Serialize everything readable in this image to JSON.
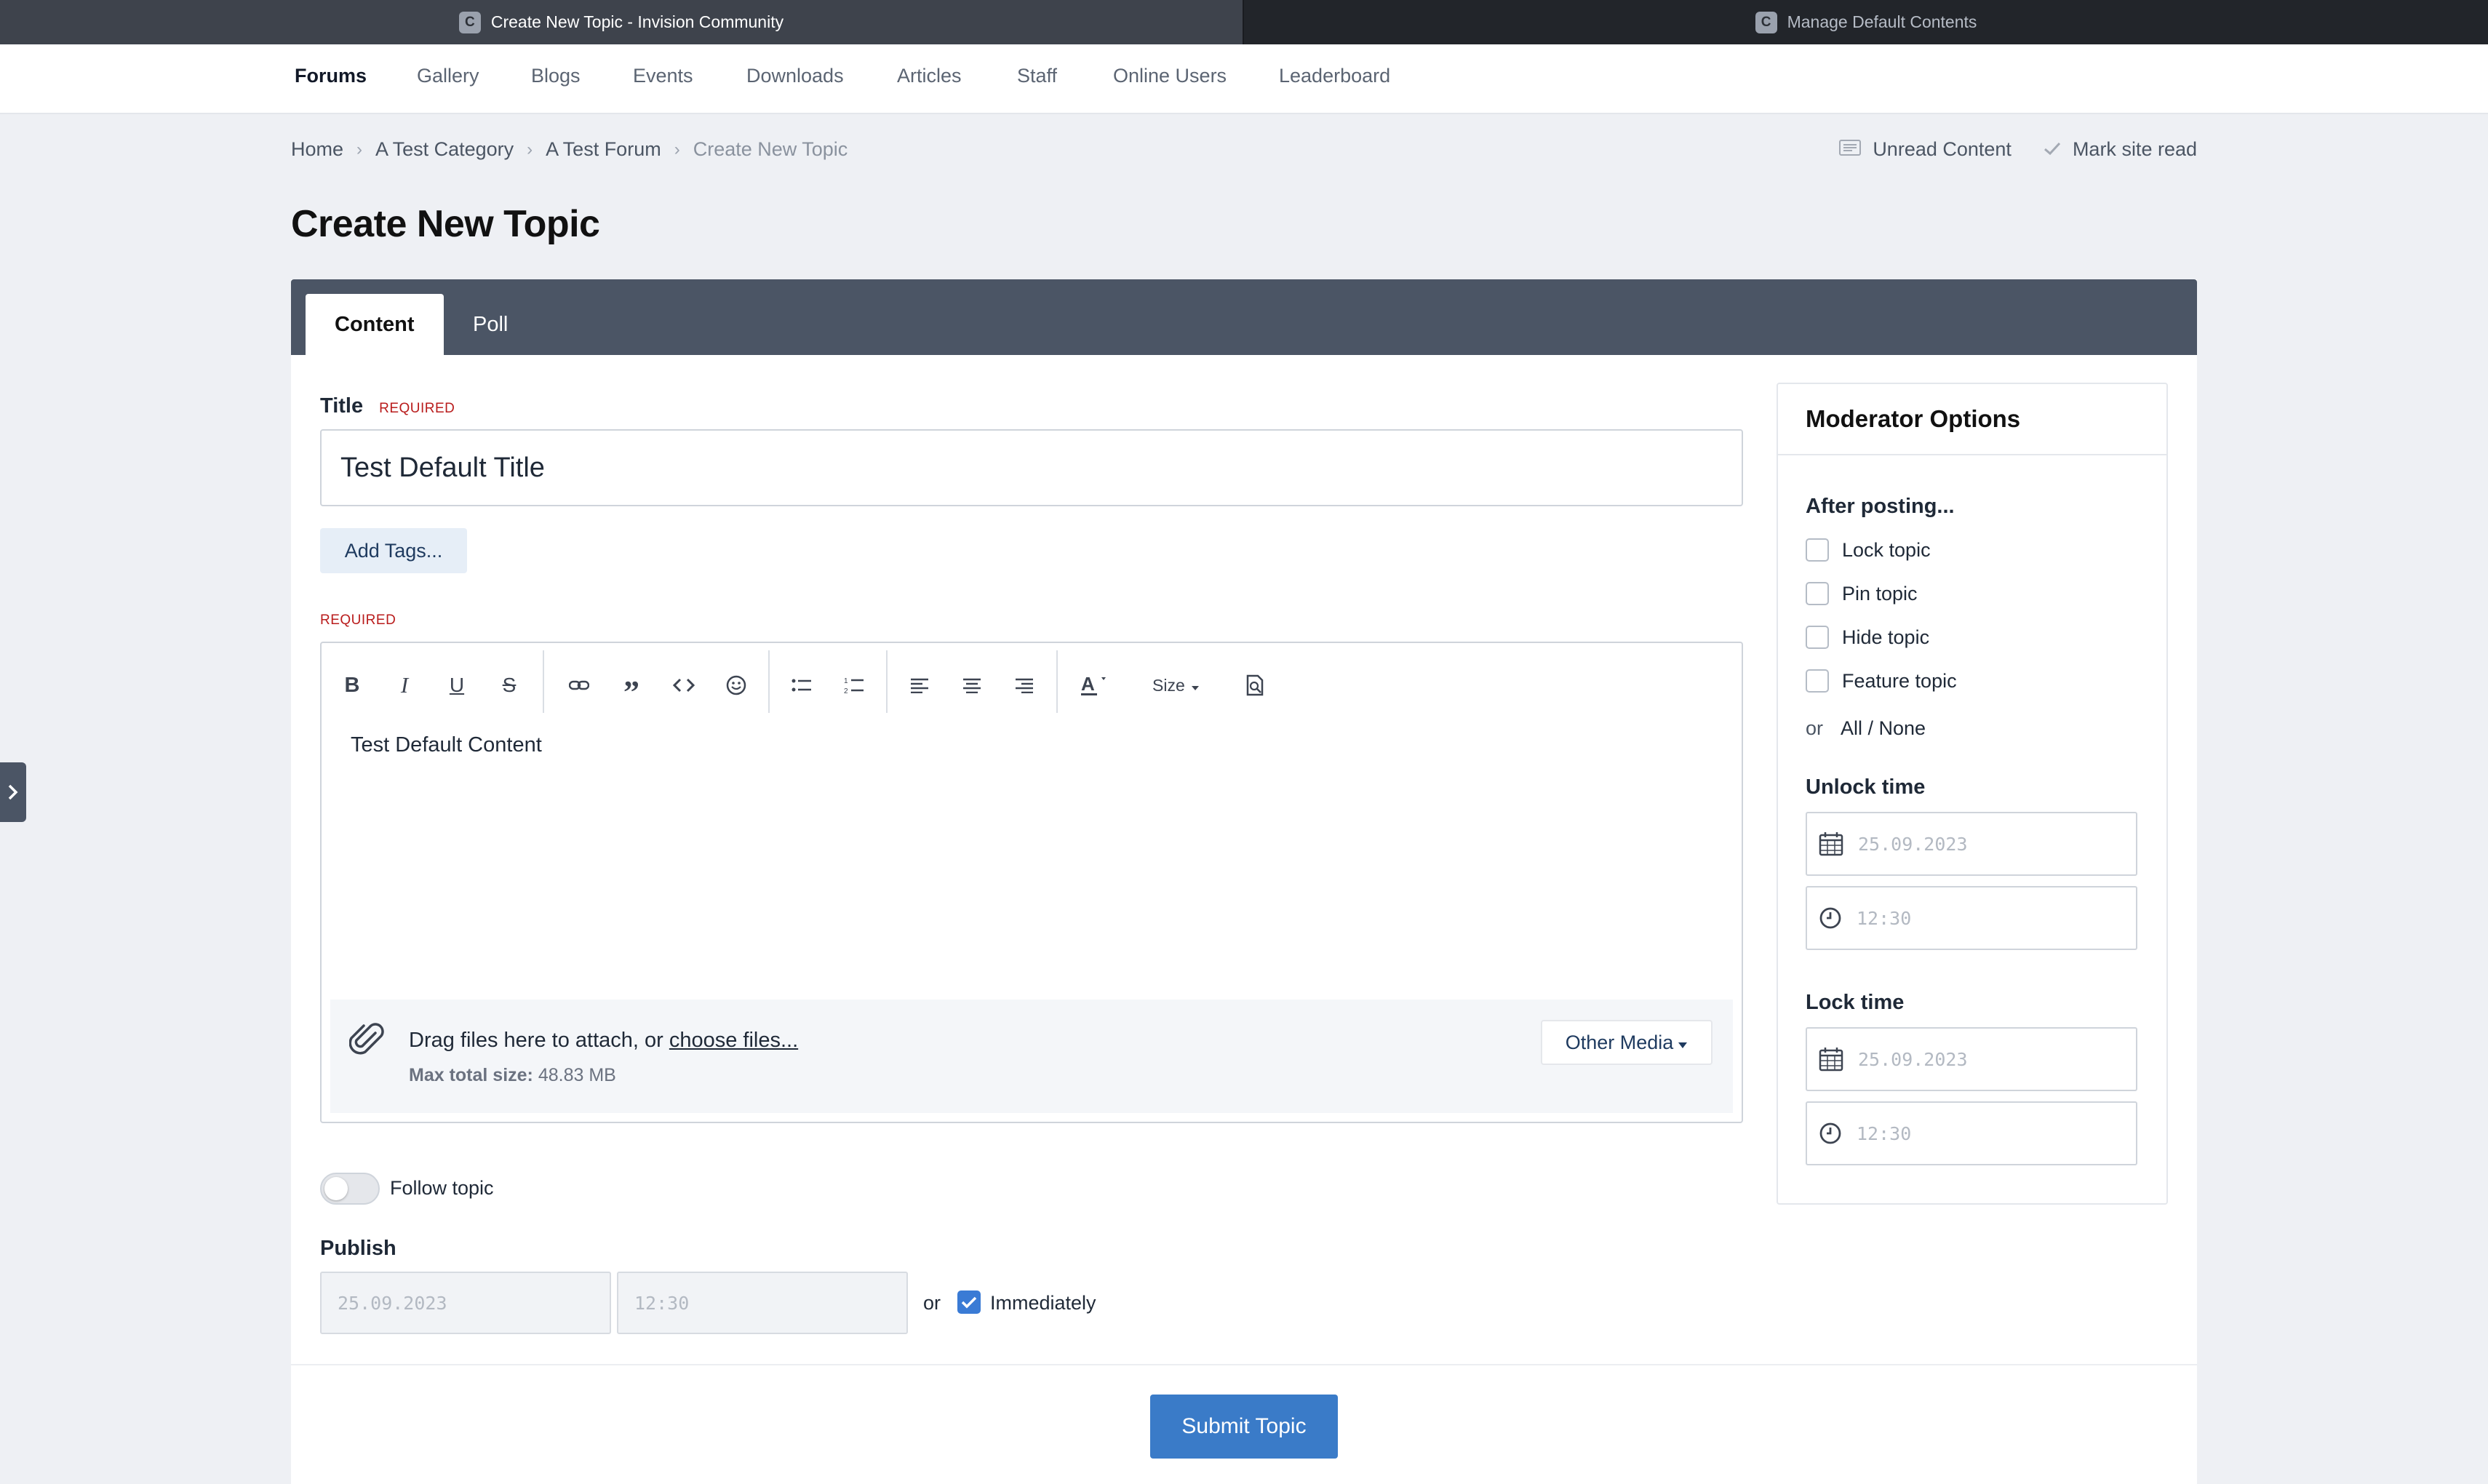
{
  "browser": {
    "tabs": [
      {
        "favicon": "C",
        "title": "Create New Topic - Invision Community",
        "active": true
      },
      {
        "favicon": "C",
        "title": "Manage Default Contents",
        "active": false
      }
    ]
  },
  "nav": {
    "items": [
      "Forums",
      "Gallery",
      "Blogs",
      "Events",
      "Downloads",
      "Articles",
      "Staff",
      "Online Users",
      "Leaderboard"
    ],
    "active": "Forums"
  },
  "breadcrumb": [
    "Home",
    "A Test Category",
    "A Test Forum",
    "Create New Topic"
  ],
  "top_actions": {
    "unread": "Unread Content",
    "mark_read": "Mark site read"
  },
  "page_title": "Create New Topic",
  "form_tabs": [
    "Content",
    "Poll"
  ],
  "title_field": {
    "label": "Title",
    "required": "REQUIRED",
    "value": "Test Default Title"
  },
  "tags_button": "Add Tags...",
  "content_field": {
    "required": "REQUIRED",
    "value": "Test Default Content",
    "size_label": "Size"
  },
  "attachments": {
    "drag_text": "Drag files here to attach, or ",
    "choose_link": "choose files...",
    "max_label": "Max total size:",
    "max_value": "48.83 MB",
    "other_media": "Other Media"
  },
  "follow": {
    "label": "Follow topic",
    "on": false
  },
  "publish": {
    "label": "Publish",
    "date_placeholder": "25.09.2023",
    "time_placeholder": "12:30",
    "or": "or",
    "immediately": "Immediately",
    "immediately_checked": true
  },
  "submit_label": "Submit Topic",
  "moderator": {
    "title": "Moderator Options",
    "after_posting": "After posting...",
    "options": [
      {
        "label": "Lock topic",
        "checked": false
      },
      {
        "label": "Pin topic",
        "checked": false
      },
      {
        "label": "Hide topic",
        "checked": false
      },
      {
        "label": "Feature topic",
        "checked": false
      }
    ],
    "or": "or",
    "all_none": "All / None",
    "unlock_label": "Unlock time",
    "lock_label": "Lock time",
    "date_placeholder": "25.09.2023",
    "time_placeholder": "12:30"
  },
  "colors": {
    "nav_dark": "#4b5565",
    "accent": "#3a7bc8",
    "required": "#b91c1c"
  }
}
